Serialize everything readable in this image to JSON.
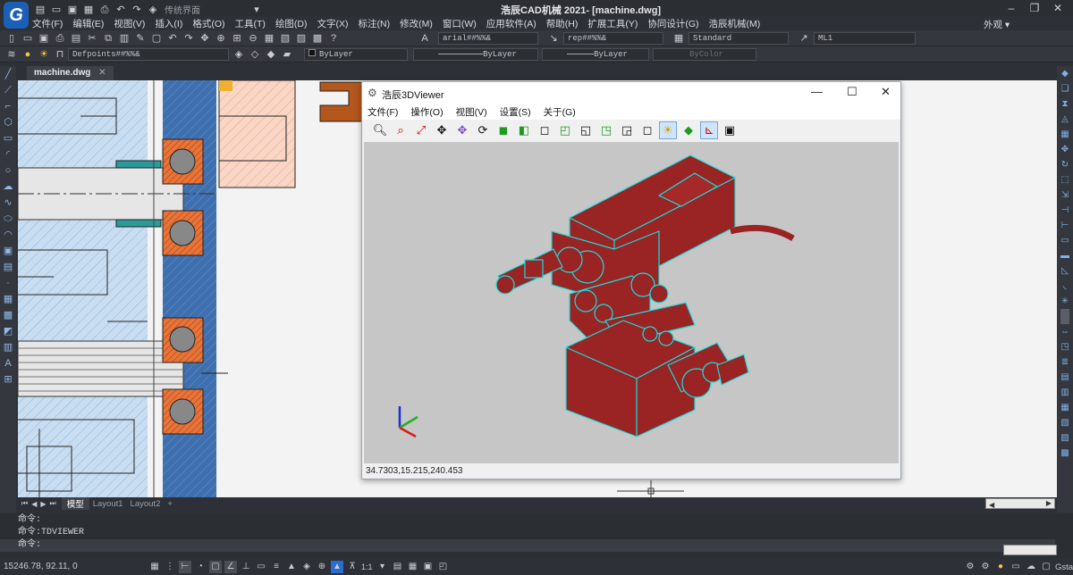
{
  "app": {
    "title": "浩辰CAD机械 2021- [machine.dwg]",
    "workspace": "传统界面",
    "appearance": "外观"
  },
  "menu": [
    "文件(F)",
    "编辑(E)",
    "视图(V)",
    "插入(I)",
    "格式(O)",
    "工具(T)",
    "绘图(D)",
    "文字(X)",
    "标注(N)",
    "修改(M)",
    "窗口(W)",
    "应用软件(A)",
    "帮助(H)",
    "扩展工具(Y)",
    "协同设计(G)",
    "浩辰机械(M)"
  ],
  "toolbar": {
    "textstyle": "arial##%%&",
    "dimstyle": "rep##%%&",
    "tablestyle": "Standard",
    "mleaderstyle": "ML1",
    "layer": "Defpoints##%%&",
    "color": "ByLayer",
    "linetype": "ByLayer",
    "lineweight": "ByLayer",
    "plotstyle": "ByColor"
  },
  "doc": {
    "tab": "machine.dwg"
  },
  "viewer": {
    "title": "浩辰3DViewer",
    "menu": [
      "文件(F)",
      "操作(O)",
      "视图(V)",
      "设置(S)",
      "关于(G)"
    ],
    "coords": "34.7303,15.215,240.453",
    "colors": {
      "body": "#9a2323",
      "edge": "#17e0e0"
    }
  },
  "layouts": [
    "模型",
    "Layout1",
    "Layout2",
    "+"
  ],
  "cmd": {
    "lines": [
      "命令:",
      "命令:TDVIEWER",
      "命令:"
    ]
  },
  "status": {
    "coords": "15246.78, 92.11, 0",
    "scale": "1:1",
    "product": "GstarCAD"
  }
}
